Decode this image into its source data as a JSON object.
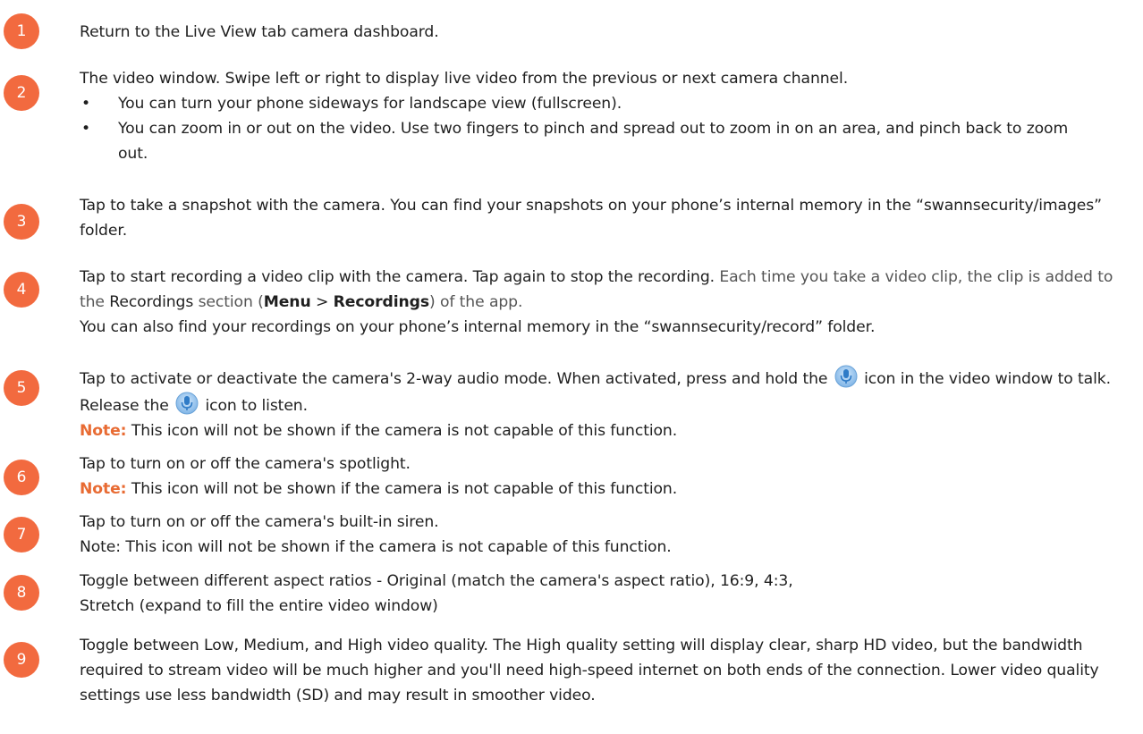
{
  "colors": {
    "badge": "#f26a3f",
    "note": "#e86b33"
  },
  "items": [
    {
      "num": "1",
      "text": "Return to the Live View tab camera dashboard."
    },
    {
      "num": "2",
      "text": "The video window. Swipe left or right to display live video from the previous or next camera channel.",
      "bullets": [
        "You can turn your phone sideways for landscape view (fullscreen).",
        "You can zoom in or out on the video. Use two fingers to pinch and spread out to zoom in on an area, and pinch back to zoom out."
      ]
    },
    {
      "num": "3",
      "text_a": "Tap to take a snapshot with the camera. You can find your snapshots on your phone’s internal memory in the “",
      "folder": "swannsecurity/images",
      "text_b": "” folder."
    },
    {
      "num": "4",
      "text_a": "Tap to start recording a video clip with the camera. Tap again to stop the recording.",
      "text_b": " Each time you take a video clip, the clip is added to the ",
      "recordings": "Recordings",
      "text_c": " section (",
      "menu": "Menu",
      "sep": " > ",
      "recordings2": "Recordings",
      "text_d": ") of the app.",
      "line2_a": "You can also find your recordings on your phone’s internal memory in the “",
      "folder": "swannsecurity/record",
      "line2_b": "” folder."
    },
    {
      "num": "5",
      "text_a": "Tap to activate or deactivate the camera's 2-way audio mode. When activated, press and hold the ",
      "icon": "microphone-icon",
      "text_b": " icon in the video window to talk. Release the ",
      "text_c": " icon to listen.",
      "note_label": "Note:",
      "note": " This icon will not be shown if the camera is not capable of this function."
    },
    {
      "num": "6",
      "text": "Tap to turn on or off the camera's spotlight.",
      "note_label": "Note:",
      "note": " This icon will not be shown if the camera is not capable of this function."
    },
    {
      "num": "7",
      "text": "Tap to turn on or off the camera's built-in siren.",
      "note": "Note: This icon will not be shown if the camera is not capable of this function."
    },
    {
      "num": "8",
      "text_a": "Toggle between different aspect ratios - ",
      "original": "Original",
      "text_b": " (match the camera's aspect ratio), ",
      "r169": "16:9",
      "comma": ", ",
      "r43": "4:3",
      "text_c": ",",
      "stretch": "Stretch",
      "text_d": " (expand to fill the entire video window)"
    },
    {
      "num": "9",
      "text_a": "Toggle between ",
      "low": "Low",
      "text_b": ", ",
      "medium": "Medium",
      "text_c": ", and ",
      "high": "High",
      "text_d": " video quality. The High quality setting will display clear, sharp HD video, but the bandwidth required to stream video will be much higher and you'll need high-speed internet on both ends of the connection. Lower video quality settings use less bandwidth (SD) and may result in smoother video."
    }
  ]
}
